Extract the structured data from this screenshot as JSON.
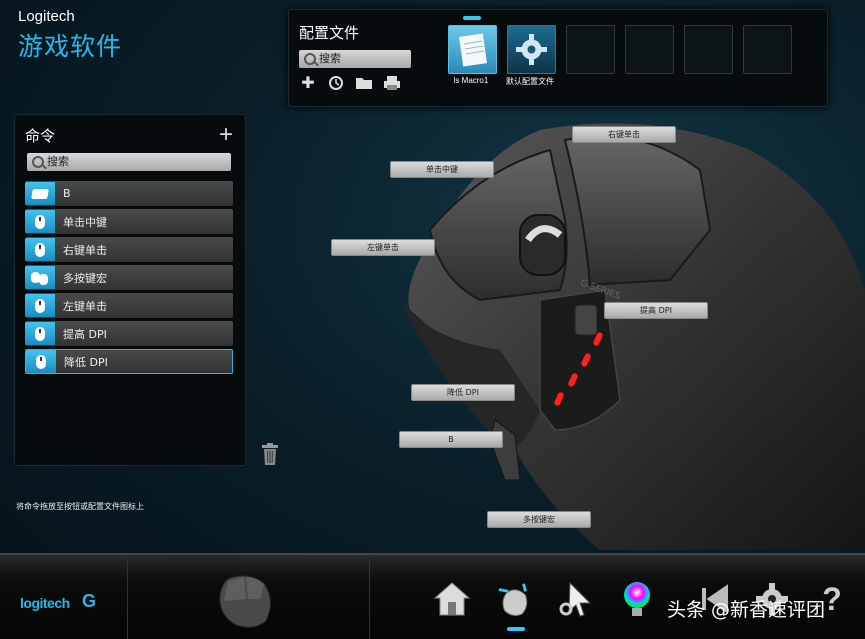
{
  "brand": {
    "name": "Logitech",
    "subtitle": "游戏软件"
  },
  "profiles": {
    "title": "配置文件",
    "search_placeholder": "搜索",
    "slots": [
      {
        "label": "ls Macro1"
      },
      {
        "label": "默认配置文件"
      }
    ]
  },
  "commands": {
    "title": "命令",
    "search_placeholder": "搜索",
    "items": [
      {
        "label": "B",
        "icon": "key-icon"
      },
      {
        "label": "单击中键",
        "icon": "mouse-icon"
      },
      {
        "label": "右键单击",
        "icon": "mouse-icon"
      },
      {
        "label": "多按键宏",
        "icon": "multi-key-icon"
      },
      {
        "label": "左键单击",
        "icon": "mouse-icon"
      },
      {
        "label": "提高 DPI",
        "icon": "mouse-icon"
      },
      {
        "label": "降低 DPI",
        "icon": "mouse-icon"
      }
    ],
    "hint": "将命令拖放至按钮或配置文件图标上"
  },
  "callouts": {
    "right_click": "右键单击",
    "middle_click": "单击中键",
    "left_click": "左键单击",
    "dpi_up": "提高 DPI",
    "dpi_down": "降低 DPI",
    "b": "B",
    "macro": "多按键宏"
  },
  "footer": {
    "logo": "logitech",
    "watermark": "头条 @新香速评团"
  },
  "colors": {
    "accent": "#29b6e8",
    "dpi_led": "#ff2020"
  }
}
